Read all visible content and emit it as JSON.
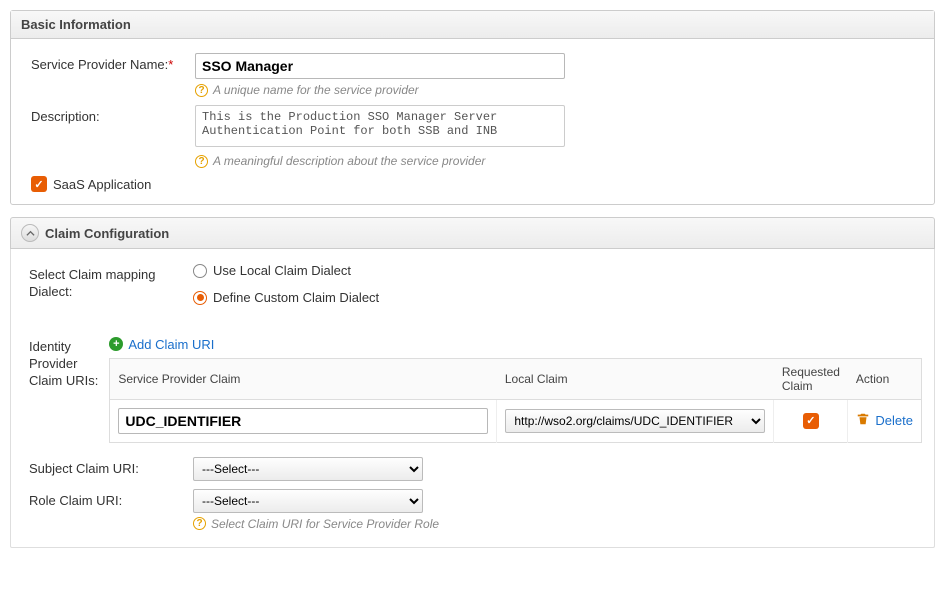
{
  "basic": {
    "header": "Basic Information",
    "service_provider_label": "Service Provider Name:",
    "service_provider_value": "SSO Manager",
    "service_provider_help": "A unique name for the service provider",
    "description_label": "Description:",
    "description_value": "This is the Production SSO Manager Server Authentication Point for both SSB and INB",
    "description_help": "A meaningful description about the service provider",
    "saas_label": "SaaS Application",
    "saas_checked": true
  },
  "claim": {
    "header": "Claim Configuration",
    "dialect_label": "Select Claim mapping Dialect:",
    "dialect_options": {
      "local": "Use Local Claim Dialect",
      "custom": "Define Custom Claim Dialect"
    },
    "dialect_selected": "custom",
    "idp_claim_label": "Identity Provider Claim URIs:",
    "add_claim_label": "Add Claim URI",
    "table_headers": {
      "sp_claim": "Service Provider Claim",
      "local_claim": "Local Claim",
      "requested": "Requested Claim",
      "action": "Action"
    },
    "rows": [
      {
        "sp_claim": "UDC_IDENTIFIER",
        "local_claim": "http://wso2.org/claims/UDC_IDENTIFIER",
        "requested": true
      }
    ],
    "delete_label": "Delete",
    "subject_label": "Subject Claim URI:",
    "subject_value": "---Select---",
    "role_label": "Role Claim URI:",
    "role_value": "---Select---",
    "role_help": "Select Claim URI for Service Provider Role"
  }
}
